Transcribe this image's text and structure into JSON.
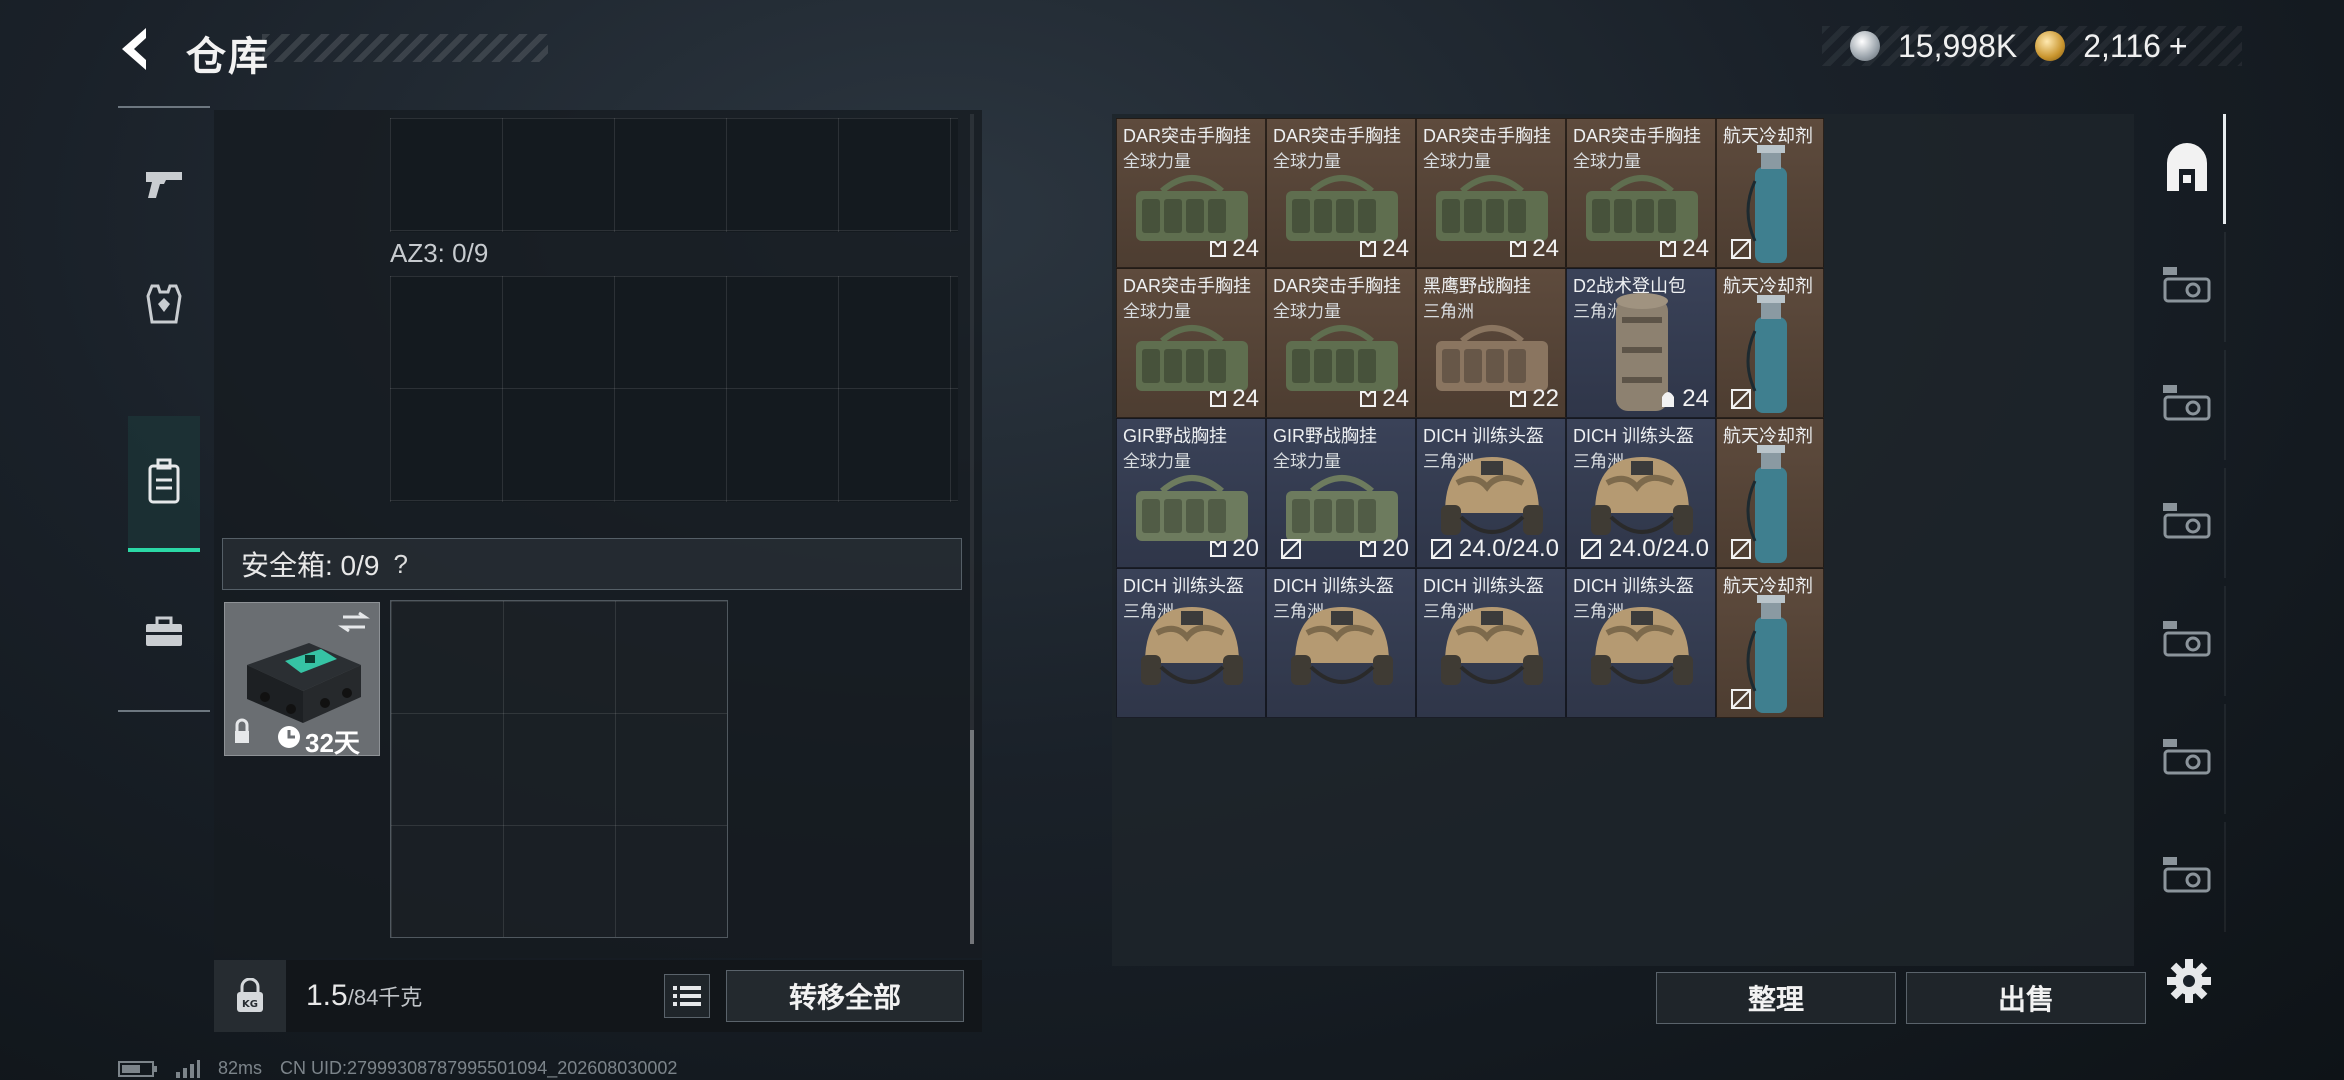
{
  "header": {
    "title": "仓库"
  },
  "currency": {
    "silver": "15,998K",
    "gold": "2,116",
    "plus": "+"
  },
  "left_nav": {
    "items": [
      "weapons",
      "armor",
      "backpack",
      "case"
    ]
  },
  "left_panel": {
    "az_label": "AZ3: 0/9",
    "safe_box_label": "安全箱: 0/9",
    "help_mark": "?",
    "safe_item": {
      "days": "32天"
    },
    "weight_value": "1.5",
    "weight_max": "/84千克",
    "transfer_all": "转移全部"
  },
  "inventory": {
    "rows": [
      [
        {
          "name": "DAR突击手胸挂",
          "sub": "全球力量",
          "stat": "24",
          "color": "brown",
          "kind": "rig"
        },
        {
          "name": "DAR突击手胸挂",
          "sub": "全球力量",
          "stat": "24",
          "color": "brown",
          "kind": "rig"
        },
        {
          "name": "DAR突击手胸挂",
          "sub": "全球力量",
          "stat": "24",
          "color": "brown",
          "kind": "rig"
        },
        {
          "name": "DAR突击手胸挂",
          "sub": "全球力量",
          "stat": "24",
          "color": "brown",
          "kind": "rig"
        },
        {
          "name": "航天冷却剂",
          "sub": "",
          "stat": "",
          "color": "brown",
          "kind": "coolant"
        }
      ],
      [
        {
          "name": "DAR突击手胸挂",
          "sub": "全球力量",
          "stat": "24",
          "color": "brown",
          "kind": "rig"
        },
        {
          "name": "DAR突击手胸挂",
          "sub": "全球力量",
          "stat": "24",
          "color": "brown",
          "kind": "rig"
        },
        {
          "name": "黑鹰野战胸挂",
          "sub": "三角洲",
          "stat": "22",
          "color": "brown",
          "kind": "rig-tan"
        },
        {
          "name": "D2战术登山包",
          "sub": "三角洲",
          "stat": "24",
          "color": "blue",
          "kind": "pack"
        },
        {
          "name": "航天冷却剂",
          "sub": "",
          "stat": "",
          "color": "brown",
          "kind": "coolant"
        }
      ],
      [
        {
          "name": "GIR野战胸挂",
          "sub": "全球力量",
          "stat": "20",
          "color": "blue",
          "kind": "rig"
        },
        {
          "name": "GIR野战胸挂",
          "sub": "全球力量",
          "stat": "20",
          "color": "blue",
          "kind": "rig"
        },
        {
          "name": "DICH 训练头盔",
          "sub": "三角洲",
          "stat": "24.0/24.0",
          "color": "blue",
          "kind": "helmet"
        },
        {
          "name": "DICH 训练头盔",
          "sub": "三角洲",
          "stat": "24.0/24.0",
          "color": "blue",
          "kind": "helmet"
        },
        {
          "name": "航天冷却剂",
          "sub": "",
          "stat": "",
          "color": "brown",
          "kind": "coolant"
        }
      ],
      [
        {
          "name": "DICH 训练头盔",
          "sub": "三角洲",
          "stat": "",
          "color": "blue",
          "kind": "helmet"
        },
        {
          "name": "DICH 训练头盔",
          "sub": "三角洲",
          "stat": "",
          "color": "blue",
          "kind": "helmet"
        },
        {
          "name": "DICH 训练头盔",
          "sub": "三角洲",
          "stat": "",
          "color": "blue",
          "kind": "helmet"
        },
        {
          "name": "DICH 训练头盔",
          "sub": "三角洲",
          "stat": "",
          "color": "blue",
          "kind": "helmet"
        },
        {
          "name": "航天冷却剂",
          "sub": "",
          "stat": "",
          "color": "brown",
          "kind": "coolant"
        }
      ]
    ]
  },
  "right_nav": {
    "items": [
      "all",
      "III-1",
      "V",
      "IV-1",
      "IV-2",
      "III-2",
      "III-3"
    ]
  },
  "buttons": {
    "sort": "整理",
    "sell": "出售"
  },
  "status": {
    "ping": "82ms",
    "uid": "CN UID:27999308787995501094_202608030002"
  },
  "colors": {
    "accent": "#2bd8a6",
    "brown_cell": "#5e4b3d",
    "blue_cell": "#3a4258"
  }
}
